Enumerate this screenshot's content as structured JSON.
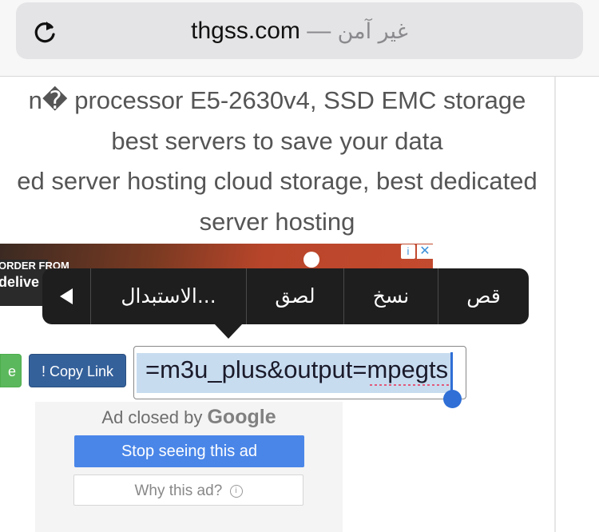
{
  "browser": {
    "url_host": "thgss.com",
    "url_separator": "—",
    "url_security": "غير آمن",
    "reload_icon": "reload-icon"
  },
  "page": {
    "desc_lines": [
      "n� processor E5-2630v4, SSD EMC storage",
      "best servers to save your data",
      "ed server hosting cloud storage, best dedicated",
      "server hosting"
    ]
  },
  "ad_banner": {
    "order_text": "ORDER FROM",
    "brand_text": "delive",
    "info_icon": "info-icon",
    "close_icon": "close-icon"
  },
  "edit_menu": {
    "more_icon": "left-arrow-icon",
    "items": [
      "الاستبدال...",
      "لصق",
      "نسخ",
      "قص"
    ]
  },
  "buttons": {
    "green_label": "e",
    "copy_link_label": "! Copy Link"
  },
  "field": {
    "value": "=m3u_plus&output=mpegts"
  },
  "google_ad": {
    "closed_by": "Ad closed by",
    "logo": "Google",
    "stop_label": "Stop seeing this ad",
    "why_label": "Why this ad?",
    "info_glyph": "i"
  },
  "colors": {
    "menu_bg": "#1e1e1e",
    "selection": "#c8dcf0",
    "caret": "#2f6fd6",
    "copy_button": "#35619b",
    "google_button": "#4a86e8"
  }
}
